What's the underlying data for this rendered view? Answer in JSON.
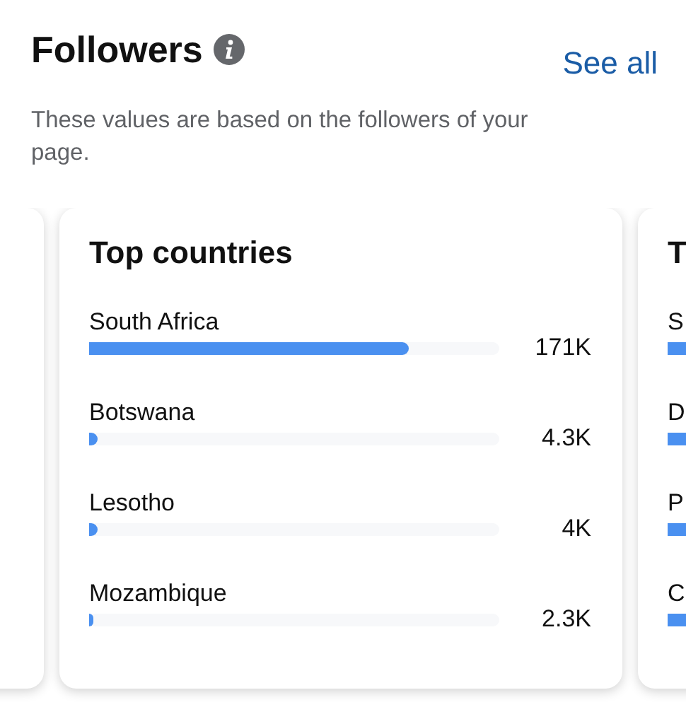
{
  "header": {
    "title": "Followers",
    "link": "See all",
    "description": "These values are based on the followers of your page."
  },
  "cards": [
    {
      "title": "Top countries",
      "rows": [
        {
          "name": "South Africa",
          "level": 0.78,
          "value": "171K"
        },
        {
          "name": "Botswana",
          "level": 0.02,
          "value": "4.3K"
        },
        {
          "name": "Lesotho",
          "level": 0.019,
          "value": "4K"
        },
        {
          "name": "Mozambique",
          "level": 0.011,
          "value": "2.3K"
        }
      ]
    },
    {
      "title": "T",
      "rows": [
        {
          "name": "S"
        },
        {
          "name": "D"
        },
        {
          "name": "P"
        },
        {
          "name": "C"
        }
      ]
    }
  ]
}
